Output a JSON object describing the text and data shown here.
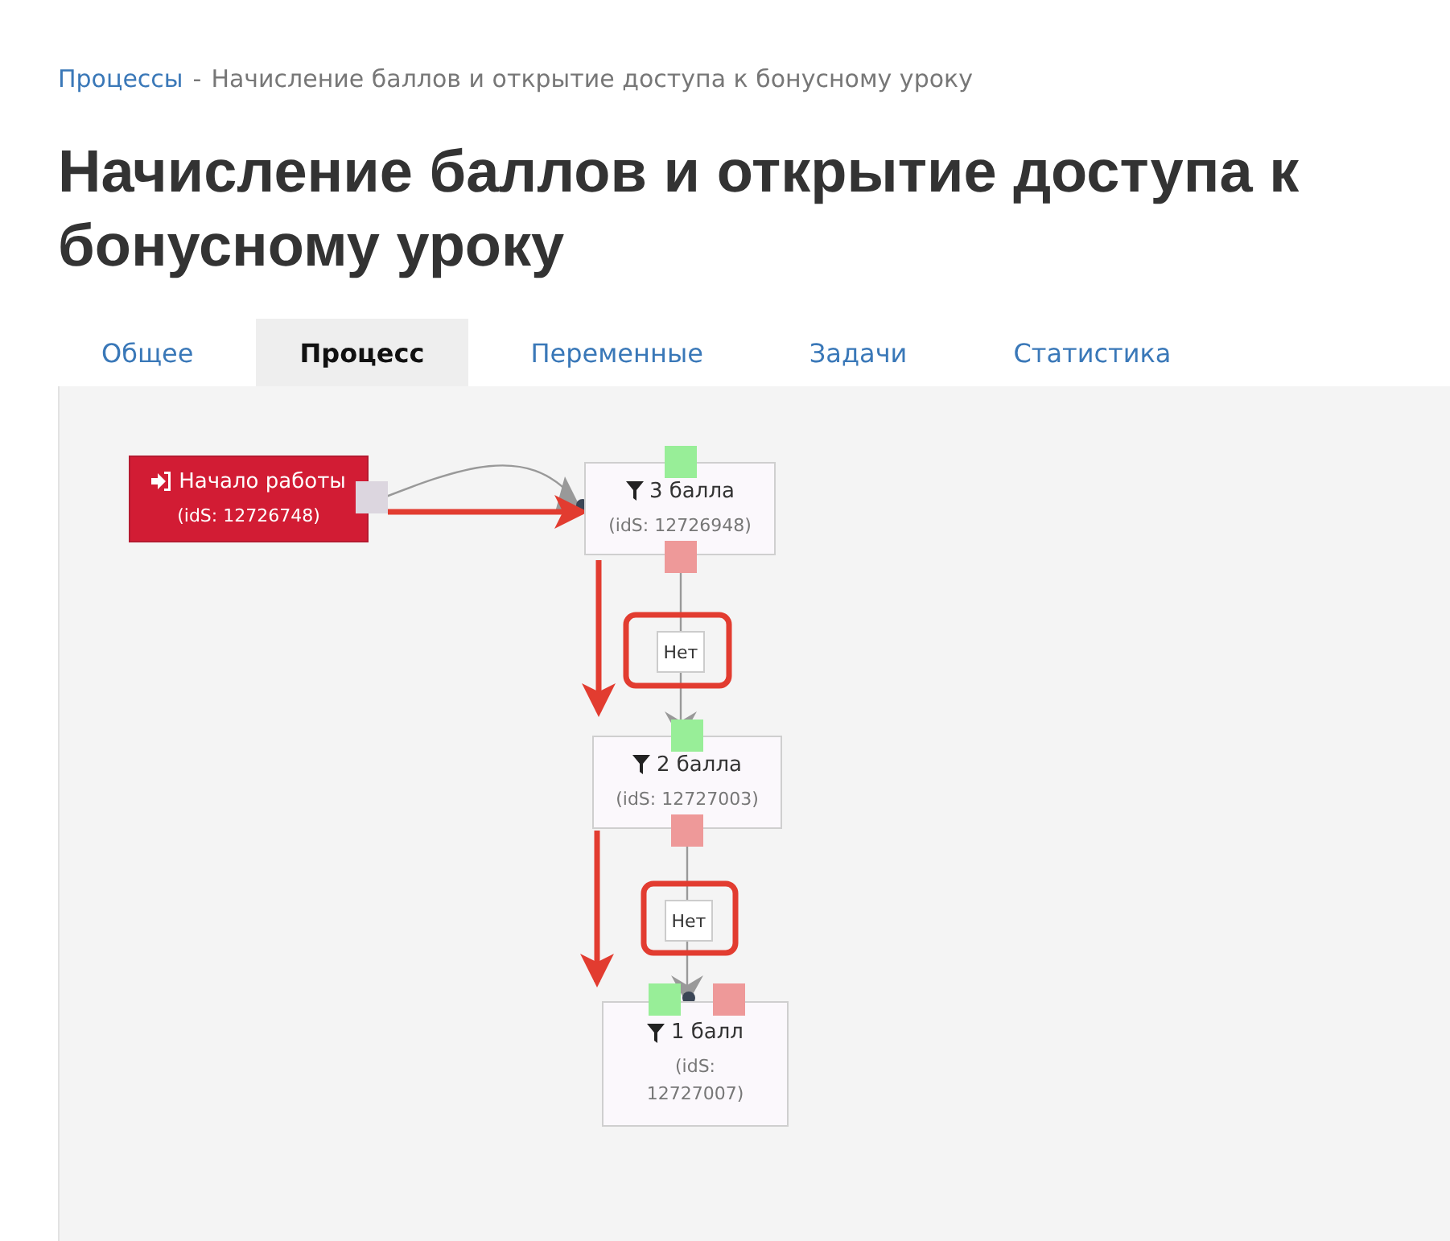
{
  "breadcrumb": {
    "link": "Процессы",
    "separator": "-",
    "current": "Начисление баллов и открытие доступа к бонусному уроку"
  },
  "title": "Начисление баллов и открытие доступа к бонусному уроку",
  "tabs": [
    {
      "label": "Общее",
      "selected": false
    },
    {
      "label": "Процесс",
      "selected": true
    },
    {
      "label": "Переменные",
      "selected": false
    },
    {
      "label": "Задачи",
      "selected": false
    },
    {
      "label": "Статистика",
      "selected": false
    }
  ],
  "diagram": {
    "nodes": [
      {
        "kind": "start",
        "label": "Начало работы",
        "ids": "(idS: 12726748)"
      },
      {
        "kind": "filter",
        "label": "3 балла",
        "ids": "(idS: 12726948)"
      },
      {
        "kind": "filter",
        "label": "2 балла",
        "ids": "(idS: 12727003)"
      },
      {
        "kind": "filter",
        "label": "1 балл",
        "ids": "(idS: 12727007)"
      }
    ],
    "edge_labels": [
      "Нет",
      "Нет"
    ]
  }
}
